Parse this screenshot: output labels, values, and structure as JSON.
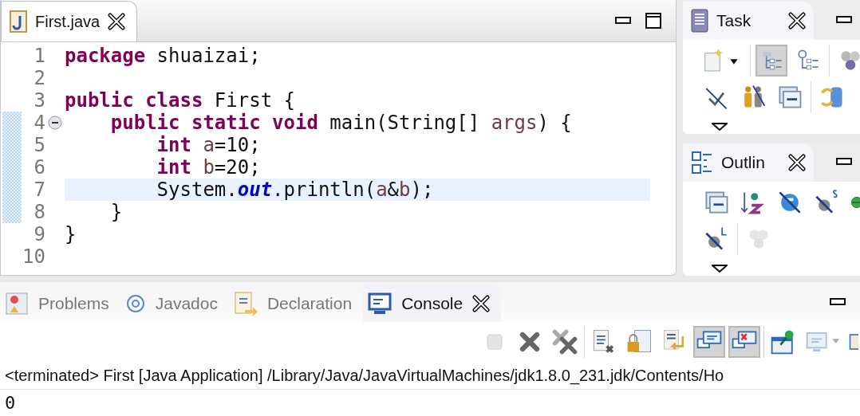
{
  "editor": {
    "tab": {
      "label": "First.java",
      "selected": true
    },
    "lines": [
      {
        "number": "1",
        "current": false,
        "foldable": false,
        "marked": false,
        "tokens": [
          {
            "kind": "keyword",
            "text": "package"
          },
          {
            "kind": "plain",
            "text": " shuaizai;"
          }
        ]
      },
      {
        "number": "2",
        "current": false,
        "foldable": false,
        "marked": false
      },
      {
        "number": "3",
        "current": false,
        "foldable": false,
        "marked": false,
        "tokens": [
          {
            "kind": "keyword",
            "text": "public"
          },
          {
            "kind": "keyword",
            "text": " class"
          },
          {
            "kind": "plain",
            "text": " First {"
          }
        ]
      },
      {
        "number": "4",
        "current": false,
        "foldable": true,
        "marked": true,
        "tokens": [
          {
            "kind": "keyword",
            "text": "    public"
          },
          {
            "kind": "keyword",
            "text": " static"
          },
          {
            "kind": "keyword",
            "text": " void"
          },
          {
            "kind": "plain",
            "text": " main(String[] "
          },
          {
            "kind": "variable",
            "text": "args"
          },
          {
            "kind": "plain",
            "text": ") {"
          }
        ]
      },
      {
        "number": "5",
        "current": false,
        "foldable": false,
        "marked": true,
        "tokens": [
          {
            "kind": "keyword",
            "text": "        int"
          },
          {
            "kind": "variable",
            "text": " a"
          },
          {
            "kind": "plain",
            "text": "=10;"
          }
        ]
      },
      {
        "number": "6",
        "current": false,
        "foldable": false,
        "marked": true,
        "tokens": [
          {
            "kind": "keyword",
            "text": "        int"
          },
          {
            "kind": "variable",
            "text": " b"
          },
          {
            "kind": "plain",
            "text": "=20;"
          }
        ]
      },
      {
        "number": "7",
        "current": true,
        "foldable": false,
        "marked": true,
        "tokens": [
          {
            "kind": "plain",
            "text": "        System."
          },
          {
            "kind": "field",
            "text": "out"
          },
          {
            "kind": "plain",
            "text": ".println("
          },
          {
            "kind": "variable",
            "text": "a"
          },
          {
            "kind": "plain",
            "text": "&"
          },
          {
            "kind": "variable",
            "text": "b"
          },
          {
            "kind": "plain",
            "text": ");"
          }
        ]
      },
      {
        "number": "8",
        "current": false,
        "foldable": false,
        "marked": true,
        "tokens": [
          {
            "kind": "plain",
            "text": "    }"
          }
        ]
      },
      {
        "number": "9",
        "current": false,
        "foldable": false,
        "marked": false,
        "tokens": [
          {
            "kind": "plain",
            "text": "}"
          }
        ]
      },
      {
        "number": "10",
        "current": false,
        "foldable": false,
        "marked": false
      }
    ]
  },
  "task": {
    "title": "Task",
    "toolbar_rows": [
      [
        {
          "kind": "new-task",
          "pressed": false
        },
        {
          "kind": "separator"
        },
        {
          "kind": "tree",
          "pressed": true
        },
        {
          "kind": "clock-tree",
          "pressed": false
        },
        {
          "kind": "separator"
        },
        {
          "kind": "spheres",
          "pressed": false
        }
      ],
      [
        {
          "kind": "hide-check",
          "pressed": false
        },
        {
          "kind": "persons",
          "pressed": false
        },
        {
          "kind": "collapse",
          "pressed": false
        },
        {
          "kind": "separator"
        },
        {
          "kind": "sync",
          "pressed": false
        }
      ]
    ]
  },
  "outline": {
    "title": "Outlin",
    "toolbar_rows": [
      [
        {
          "kind": "collapse",
          "pressed": false
        },
        {
          "kind": "sort",
          "pressed": false
        },
        {
          "kind": "hide-field",
          "pressed": false
        },
        {
          "kind": "hide-static",
          "pressed": false
        },
        {
          "kind": "green-dot",
          "pressed": false
        }
      ],
      [
        {
          "kind": "hide-local",
          "pressed": false
        },
        {
          "kind": "separator"
        },
        {
          "kind": "faded-spheres",
          "pressed": false
        }
      ]
    ]
  },
  "bottom_tabs": [
    {
      "label": "Problems",
      "selected": false
    },
    {
      "label": "Javadoc",
      "selected": false
    },
    {
      "label": "Declaration",
      "selected": false
    },
    {
      "label": "Console",
      "selected": true
    }
  ],
  "console_toolbar": [
    {
      "kind": "stop",
      "pressed": false
    },
    {
      "kind": "remove",
      "pressed": false
    },
    {
      "kind": "remove-all",
      "pressed": false
    },
    {
      "kind": "separator"
    },
    {
      "kind": "clear",
      "pressed": false
    },
    {
      "kind": "scroll-lock",
      "pressed": false
    },
    {
      "kind": "word-wrap",
      "pressed": false
    },
    {
      "kind": "show-output",
      "pressed": true
    },
    {
      "kind": "show-error",
      "pressed": true
    },
    {
      "kind": "separator"
    },
    {
      "kind": "pin",
      "pressed": false
    },
    {
      "kind": "display",
      "pressed": false
    },
    {
      "kind": "new-console",
      "pressed": false
    }
  ],
  "console": {
    "header": "<terminated> First [Java Application] /Library/Java/JavaVirtualMachines/jdk1.8.0_231.jdk/Contents/Ho",
    "output": "0"
  }
}
